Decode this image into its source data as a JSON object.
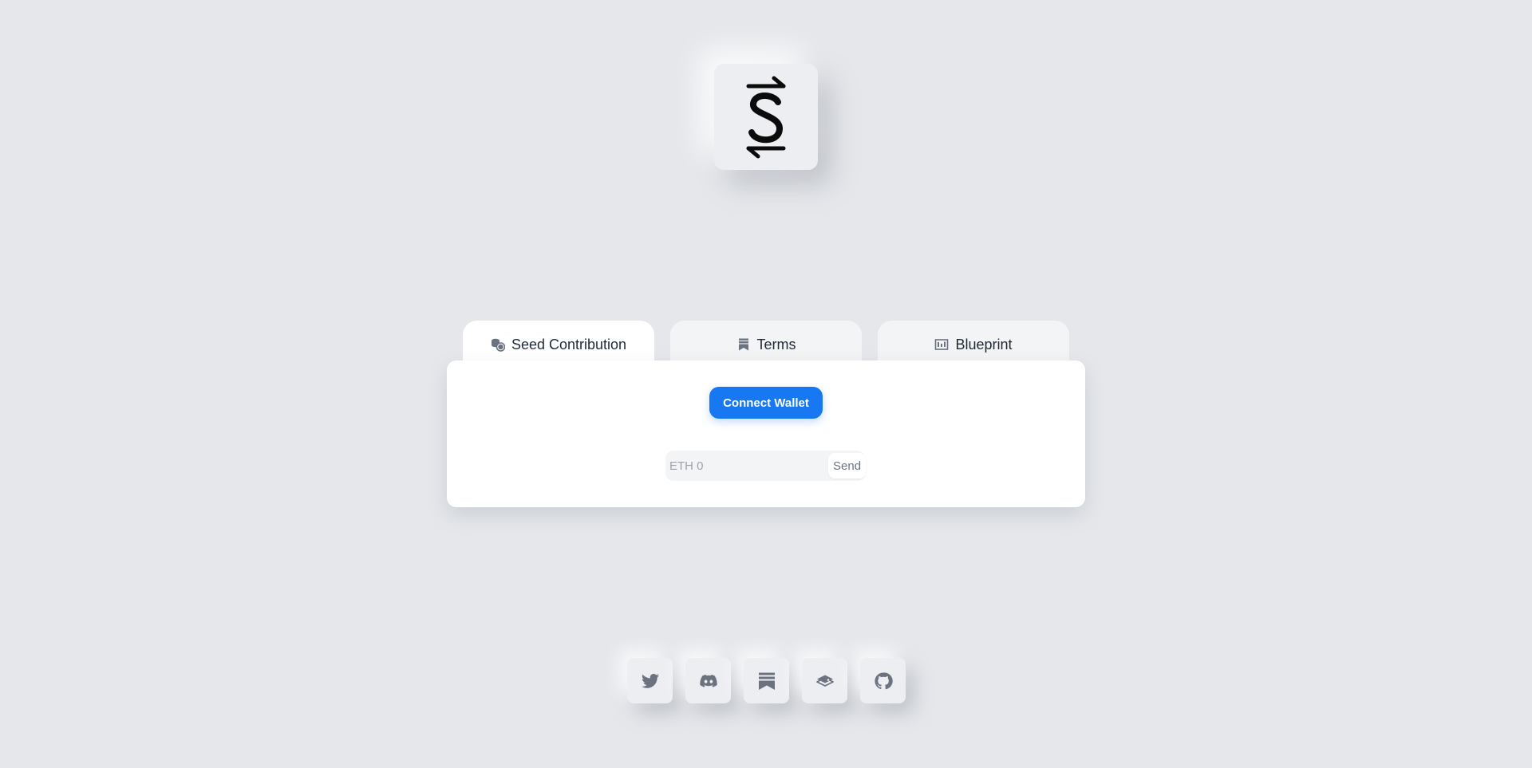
{
  "logo": {
    "icon": "dollar-swap-logo-icon"
  },
  "tabs": [
    {
      "id": "seed",
      "label": "Seed Contribution",
      "icon": "coins-icon",
      "active": true
    },
    {
      "id": "terms",
      "label": "Terms",
      "icon": "bookmark-icon",
      "active": false
    },
    {
      "id": "blueprint",
      "label": "Blueprint",
      "icon": "blueprint-icon",
      "active": false
    }
  ],
  "card": {
    "connect_label": "Connect Wallet",
    "amount_placeholder": "ETH 0",
    "send_label": "Send"
  },
  "social": [
    {
      "name": "twitter-icon"
    },
    {
      "name": "discord-icon"
    },
    {
      "name": "substack-icon"
    },
    {
      "name": "gitbook-icon"
    },
    {
      "name": "github-icon"
    }
  ],
  "colors": {
    "background": "#e5e7eb",
    "accent": "#1778f2",
    "card": "#ffffff",
    "icon": "#6b7280"
  }
}
